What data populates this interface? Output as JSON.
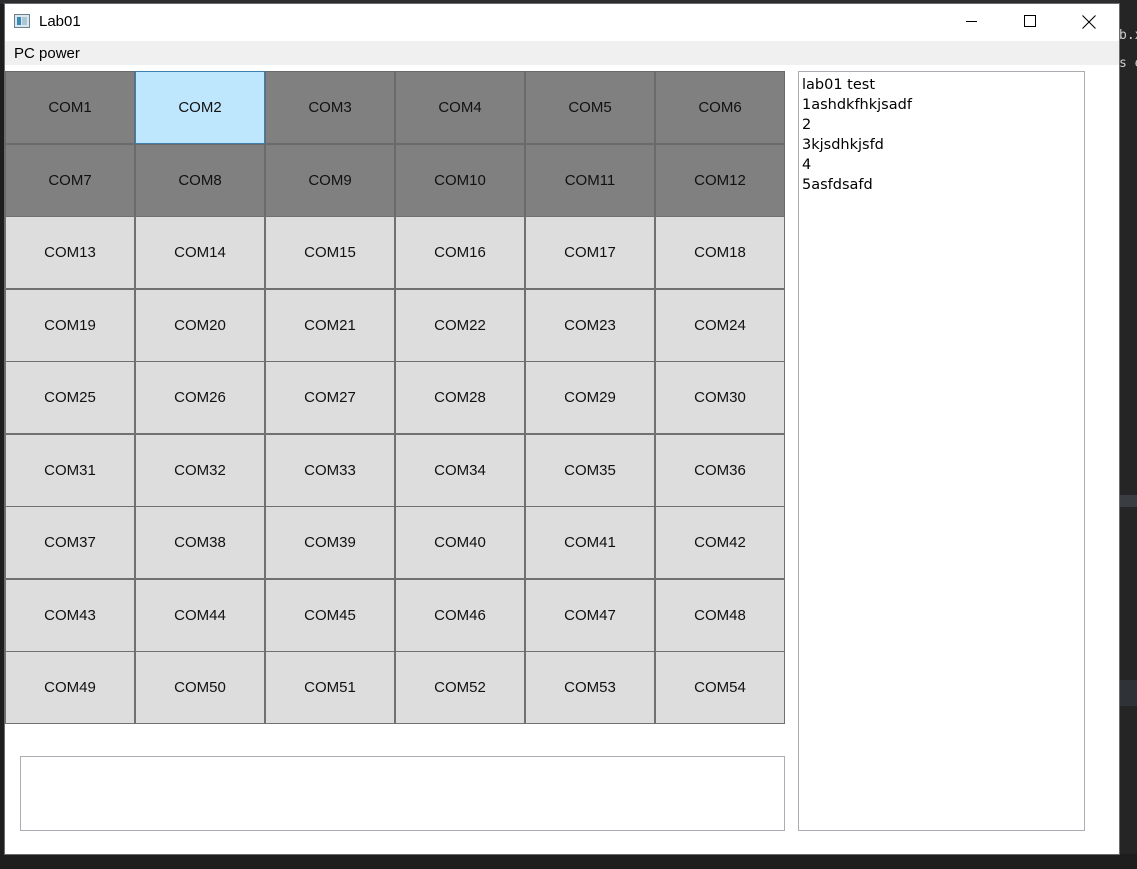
{
  "window": {
    "title": "Lab01"
  },
  "menu": {
    "items": [
      "PC power"
    ]
  },
  "grid": {
    "cells": [
      {
        "label": "COM1",
        "state": "dark"
      },
      {
        "label": "COM2",
        "state": "selected"
      },
      {
        "label": "COM3",
        "state": "dark"
      },
      {
        "label": "COM4",
        "state": "dark"
      },
      {
        "label": "COM5",
        "state": "dark"
      },
      {
        "label": "COM6",
        "state": "dark"
      },
      {
        "label": "COM7",
        "state": "dark"
      },
      {
        "label": "COM8",
        "state": "dark"
      },
      {
        "label": "COM9",
        "state": "dark"
      },
      {
        "label": "COM10",
        "state": "dark"
      },
      {
        "label": "COM11",
        "state": "dark"
      },
      {
        "label": "COM12",
        "state": "dark"
      },
      {
        "label": "COM13",
        "state": "normal"
      },
      {
        "label": "COM14",
        "state": "normal"
      },
      {
        "label": "COM15",
        "state": "normal"
      },
      {
        "label": "COM16",
        "state": "normal"
      },
      {
        "label": "COM17",
        "state": "normal"
      },
      {
        "label": "COM18",
        "state": "normal"
      },
      {
        "label": "COM19",
        "state": "normal"
      },
      {
        "label": "COM20",
        "state": "normal"
      },
      {
        "label": "COM21",
        "state": "normal"
      },
      {
        "label": "COM22",
        "state": "normal"
      },
      {
        "label": "COM23",
        "state": "normal"
      },
      {
        "label": "COM24",
        "state": "normal"
      },
      {
        "label": "COM25",
        "state": "normal"
      },
      {
        "label": "COM26",
        "state": "normal"
      },
      {
        "label": "COM27",
        "state": "normal"
      },
      {
        "label": "COM28",
        "state": "normal"
      },
      {
        "label": "COM29",
        "state": "normal"
      },
      {
        "label": "COM30",
        "state": "normal"
      },
      {
        "label": "COM31",
        "state": "normal"
      },
      {
        "label": "COM32",
        "state": "normal"
      },
      {
        "label": "COM33",
        "state": "normal"
      },
      {
        "label": "COM34",
        "state": "normal"
      },
      {
        "label": "COM35",
        "state": "normal"
      },
      {
        "label": "COM36",
        "state": "normal"
      },
      {
        "label": "COM37",
        "state": "normal"
      },
      {
        "label": "COM38",
        "state": "normal"
      },
      {
        "label": "COM39",
        "state": "normal"
      },
      {
        "label": "COM40",
        "state": "normal"
      },
      {
        "label": "COM41",
        "state": "normal"
      },
      {
        "label": "COM42",
        "state": "normal"
      },
      {
        "label": "COM43",
        "state": "normal"
      },
      {
        "label": "COM44",
        "state": "normal"
      },
      {
        "label": "COM45",
        "state": "normal"
      },
      {
        "label": "COM46",
        "state": "normal"
      },
      {
        "label": "COM47",
        "state": "normal"
      },
      {
        "label": "COM48",
        "state": "normal"
      },
      {
        "label": "COM49",
        "state": "normal"
      },
      {
        "label": "COM50",
        "state": "normal"
      },
      {
        "label": "COM51",
        "state": "normal"
      },
      {
        "label": "COM52",
        "state": "normal"
      },
      {
        "label": "COM53",
        "state": "normal"
      },
      {
        "label": "COM54",
        "state": "normal"
      }
    ]
  },
  "status_box": {
    "value": ""
  },
  "log": {
    "lines": [
      "lab01 test",
      "1ashdkfhkjsadf",
      "2",
      "3kjsdhkjsfd",
      "4",
      "5asfdsafd"
    ]
  },
  "background": {
    "right_text": [
      "b.x",
      "s e"
    ]
  },
  "colors": {
    "cell_normal": "#dddddd",
    "cell_dark": "#808080",
    "cell_selected": "#bee6fd",
    "cell_selected_border": "#3c7fb1"
  },
  "icons": {
    "app": "app-window-icon",
    "minimize": "minimize-icon",
    "maximize": "maximize-icon",
    "close": "close-icon"
  }
}
